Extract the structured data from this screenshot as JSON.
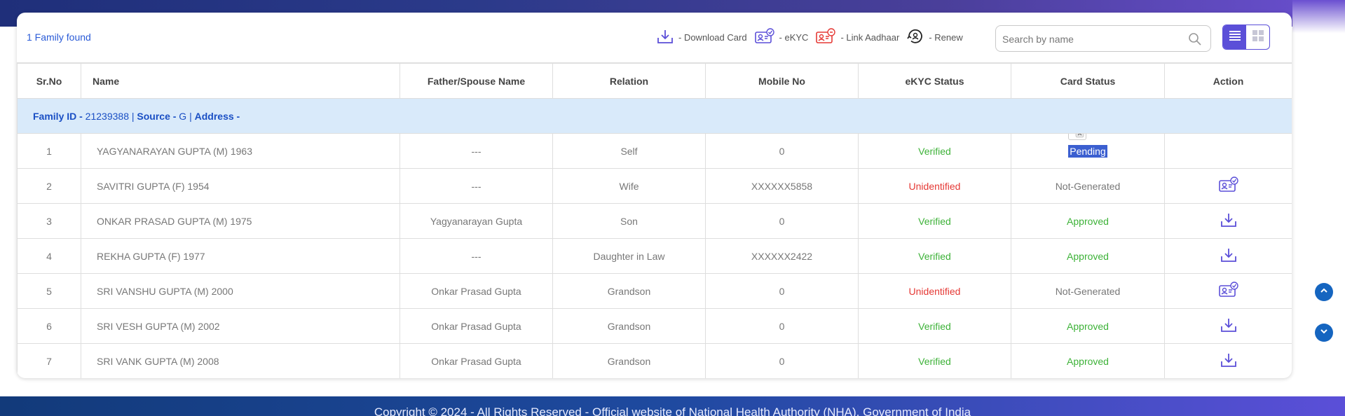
{
  "summary": {
    "found": "1 Family found"
  },
  "legend": [
    {
      "icon": "download-icon",
      "label": "- Download Card"
    },
    {
      "icon": "ekyc-icon",
      "label": "- eKYC"
    },
    {
      "icon": "link-aadhaar-icon",
      "label": "- Link Aadhaar"
    },
    {
      "icon": "renew-icon",
      "label": "- Renew"
    }
  ],
  "search": {
    "placeholder": "Search by name",
    "value": ""
  },
  "view_toggle": {
    "active": "list"
  },
  "table": {
    "headers": [
      "Sr.No",
      "Name",
      "Father/Spouse Name",
      "Relation",
      "Mobile No",
      "eKYC Status",
      "Card Status",
      "Action"
    ],
    "family": {
      "id_label": "Family ID -",
      "id_value": " 21239388 | ",
      "source_label": "Source -",
      "source_value": " G | ",
      "address_label": "Address -"
    },
    "rows": [
      {
        "sr": "1",
        "name": "YAGYANARAYAN GUPTA (M) 1963",
        "father": "---",
        "relation": "Self",
        "mobile": "0",
        "ekyc": "Verified",
        "card": "Pending",
        "action": ""
      },
      {
        "sr": "2",
        "name": "SAVITRI GUPTA (F) 1954",
        "father": "---",
        "relation": "Wife",
        "mobile": "XXXXXX5858",
        "ekyc": "Unidentified",
        "card": "Not-Generated",
        "action": "ekyc-icon"
      },
      {
        "sr": "3",
        "name": "ONKAR PRASAD GUPTA (M) 1975",
        "father": "Yagyanarayan Gupta",
        "relation": "Son",
        "mobile": "0",
        "ekyc": "Verified",
        "card": "Approved",
        "action": "download-icon"
      },
      {
        "sr": "4",
        "name": "REKHA GUPTA (F) 1977",
        "father": "---",
        "relation": "Daughter in Law",
        "mobile": "XXXXXX2422",
        "ekyc": "Verified",
        "card": "Approved",
        "action": "download-icon"
      },
      {
        "sr": "5",
        "name": "SRI VANSHU GUPTA (M) 2000",
        "father": "Onkar Prasad Gupta",
        "relation": "Grandson",
        "mobile": "0",
        "ekyc": "Unidentified",
        "card": "Not-Generated",
        "action": "ekyc-icon"
      },
      {
        "sr": "6",
        "name": "SRI VESH GUPTA (M) 2002",
        "father": "Onkar Prasad Gupta",
        "relation": "Grandson",
        "mobile": "0",
        "ekyc": "Verified",
        "card": "Approved",
        "action": "download-icon"
      },
      {
        "sr": "7",
        "name": "SRI VANK GUPTA (M) 2008",
        "father": "Onkar Prasad Gupta",
        "relation": "Grandson",
        "mobile": "0",
        "ekyc": "Verified",
        "card": "Approved",
        "action": "download-icon"
      }
    ]
  },
  "footer": {
    "text": "Copyright © 2024 - All Rights Reserved - Official website of National Health Authority (NHA), Government of India"
  },
  "colors": {
    "accent": "#5b4fd8",
    "link_blue": "#2a5bd7",
    "verified": "#3db238",
    "unidentified": "#e53935",
    "family_row_bg": "#d9eafa"
  }
}
